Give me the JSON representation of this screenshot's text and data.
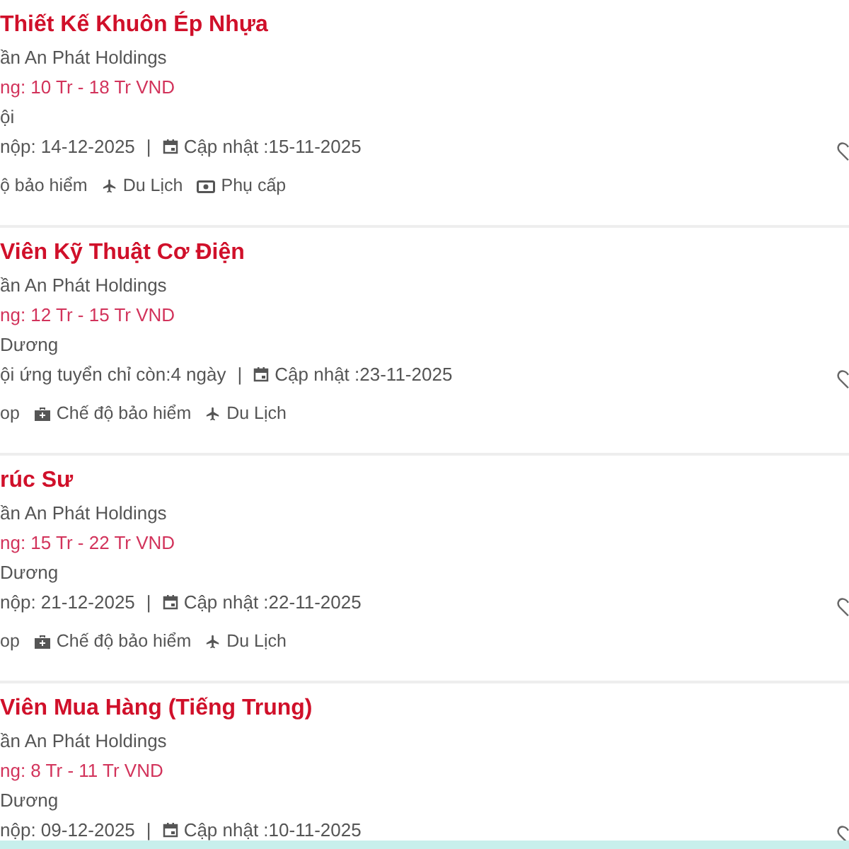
{
  "jobs": [
    {
      "title": "Thiết Kế Khuôn Ép Nhựa",
      "company": "ần An Phát Holdings",
      "salary": "ng: 10 Tr - 18 Tr VND",
      "location": "ội",
      "deadline": "nộp: 14-12-2025",
      "separator": "|",
      "updated": "Cập nhật :15-11-2025",
      "benefits": [
        {
          "kind": "text",
          "label": "ộ bảo hiểm"
        },
        {
          "kind": "plane",
          "label": "Du Lịch"
        },
        {
          "kind": "cash",
          "label": "Phụ cấp"
        }
      ]
    },
    {
      "title": "Viên Kỹ Thuật Cơ Điện",
      "company": "ần An Phát Holdings",
      "salary": "ng: 12 Tr - 15 Tr VND",
      "location": "Dương",
      "deadline": "ội ứng tuyển chỉ còn:4 ngày",
      "separator": "|",
      "updated": "Cập nhật :23-11-2025",
      "benefits": [
        {
          "kind": "text",
          "label": "op"
        },
        {
          "kind": "medkit",
          "label": "Chế độ bảo hiểm"
        },
        {
          "kind": "plane",
          "label": "Du Lịch"
        }
      ]
    },
    {
      "title": "rúc Sư",
      "company": "ần An Phát Holdings",
      "salary": "ng: 15 Tr - 22 Tr VND",
      "location": "Dương",
      "deadline": "nộp: 21-12-2025",
      "separator": "|",
      "updated": "Cập nhật :22-11-2025",
      "benefits": [
        {
          "kind": "text",
          "label": "op"
        },
        {
          "kind": "medkit",
          "label": "Chế độ bảo hiểm"
        },
        {
          "kind": "plane",
          "label": "Du Lịch"
        }
      ]
    },
    {
      "title": "Viên Mua Hàng (Tiếng Trung)",
      "company": "ần An Phát Holdings",
      "salary": "ng: 8 Tr - 11 Tr VND",
      "location": "Dương",
      "deadline": "nộp: 09-12-2025",
      "separator": "|",
      "updated": "Cập nhật :10-11-2025"
    }
  ]
}
